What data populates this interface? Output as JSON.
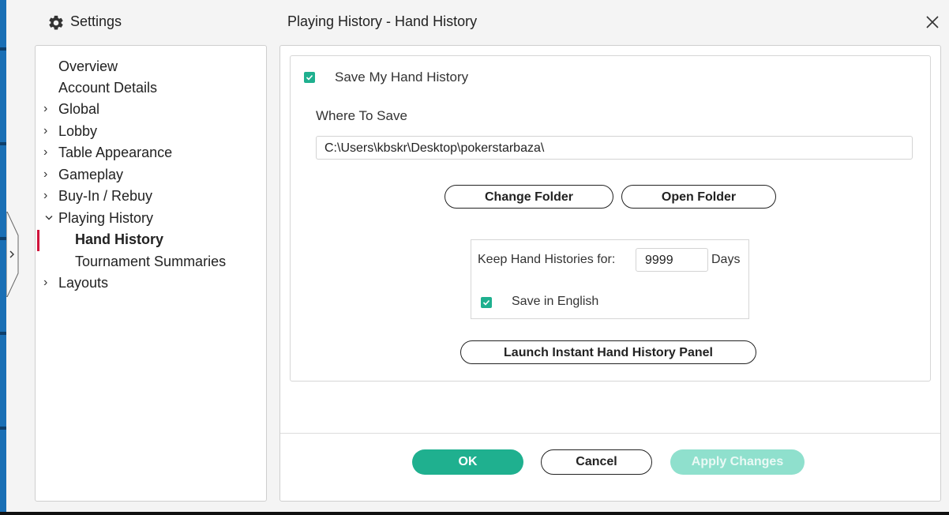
{
  "header": {
    "settings_title": "Settings",
    "page_title": "Playing History - Hand History",
    "close_glyph": "✕"
  },
  "sidebar": {
    "items": [
      {
        "label": "Overview",
        "chevron": ""
      },
      {
        "label": "Account Details",
        "chevron": ""
      },
      {
        "label": "Global",
        "chevron": ">"
      },
      {
        "label": "Lobby",
        "chevron": ">"
      },
      {
        "label": "Table Appearance",
        "chevron": ">"
      },
      {
        "label": "Gameplay",
        "chevron": ">"
      },
      {
        "label": "Buy-In / Rebuy",
        "chevron": ">"
      },
      {
        "label": "Playing History",
        "chevron": "v"
      },
      {
        "label": "Hand History",
        "chevron": ""
      },
      {
        "label": "Tournament Summaries",
        "chevron": ""
      },
      {
        "label": "Layouts",
        "chevron": ">"
      }
    ],
    "selected": "Hand History"
  },
  "main": {
    "save_history_label": "Save My Hand History",
    "save_history_checked": true,
    "where_to_save_label": "Where To Save",
    "path_value": "C:\\Users\\kbskr\\Desktop\\pokerstarbaza\\",
    "change_folder_label": "Change Folder",
    "open_folder_label": "Open Folder",
    "keep_label": "Keep Hand Histories for:",
    "keep_days_value": "9999",
    "days_label": "Days",
    "save_english_label": "Save in English",
    "save_english_checked": true,
    "launch_panel_label": "Launch Instant Hand History Panel"
  },
  "footer": {
    "ok_label": "OK",
    "cancel_label": "Cancel",
    "apply_label": "Apply Changes"
  },
  "colors": {
    "accent": "#1fb08f",
    "accent_disabled": "#8fe0cd",
    "selection_bar": "#d0143c"
  }
}
